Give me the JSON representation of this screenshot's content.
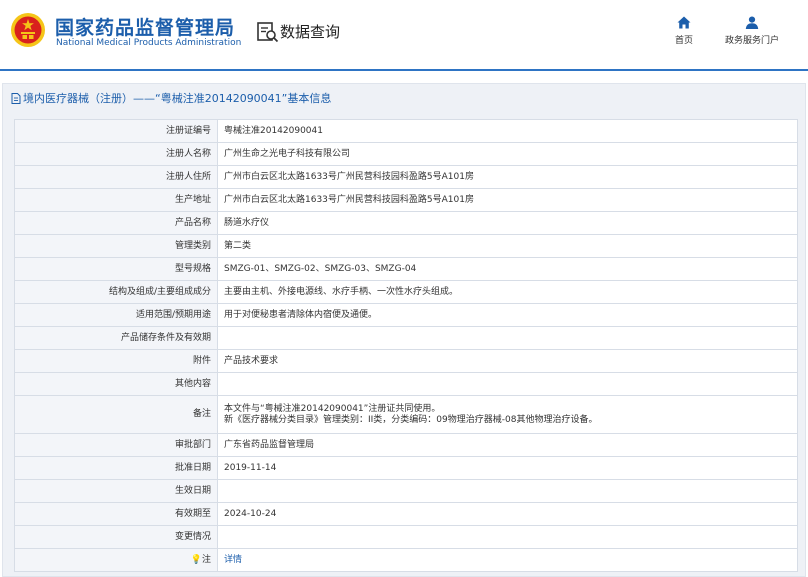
{
  "site": {
    "name_cn": "国家药品监督管理局",
    "name_en": "National Medical Products Administration"
  },
  "header": {
    "query_label": "数据查询",
    "nav": {
      "home": "首页",
      "portal": "政务服务门户"
    }
  },
  "panel": {
    "title": "境内医疗器械（注册）——“粤械注准20142090041”基本信息"
  },
  "rows": {
    "reg_no": {
      "label": "注册证编号",
      "value": "粤械注准20142090041"
    },
    "registrant": {
      "label": "注册人名称",
      "value": "广州生命之光电子科技有限公司"
    },
    "registrant_address": {
      "label": "注册人住所",
      "value": "广州市白云区北太路1633号广州民营科技园科盈路5号A101房"
    },
    "production_address": {
      "label": "生产地址",
      "value": "广州市白云区北太路1633号广州民营科技园科盈路5号A101房"
    },
    "product_name": {
      "label": "产品名称",
      "value": "肠道水疗仪"
    },
    "category": {
      "label": "管理类别",
      "value": "第二类"
    },
    "model": {
      "label": "型号规格",
      "value": "SMZG-01、SMZG-02、SMZG-03、SMZG-04"
    },
    "structure": {
      "label": "结构及组成/主要组成成分",
      "value": "主要由主机、外接电源线、水疗手柄、一次性水疗头组成。"
    },
    "scope": {
      "label": "适用范围/预期用途",
      "value": "用于对便秘患者清除体内宿便及通便。"
    },
    "storage": {
      "label": "产品储存条件及有效期",
      "value": ""
    },
    "attachment": {
      "label": "附件",
      "value": "产品技术要求"
    },
    "other": {
      "label": "其他内容",
      "value": ""
    },
    "remark": {
      "label": "备注",
      "line1": "本文件与“粤械注准20142090041”注册证共同使用。",
      "line2": "新《医疗器械分类目录》管理类别：II类，分类编码：09物理治疗器械-08其他物理治疗设备。"
    },
    "approval_dept": {
      "label": "审批部门",
      "value": "广东省药品监督管理局"
    },
    "approval_date": {
      "label": "批准日期",
      "value": "2019-11-14"
    },
    "effective_date": {
      "label": "生效日期",
      "value": ""
    },
    "valid_until": {
      "label": "有效期至",
      "value": "2024-10-24"
    },
    "changes": {
      "label": "变更情况",
      "value": ""
    },
    "note": {
      "label": "注",
      "value": "详情"
    }
  },
  "colors": {
    "brand_blue": "#1c5eab",
    "header_line": "#2e74c4",
    "emblem_red": "#d9211d",
    "emblem_gold": "#f5c518"
  },
  "icons": {
    "emblem": "national-emblem-icon",
    "query": "data-query-icon",
    "home": "home-icon",
    "portal": "user-icon",
    "title": "document-icon",
    "note": "lightbulb-icon"
  }
}
